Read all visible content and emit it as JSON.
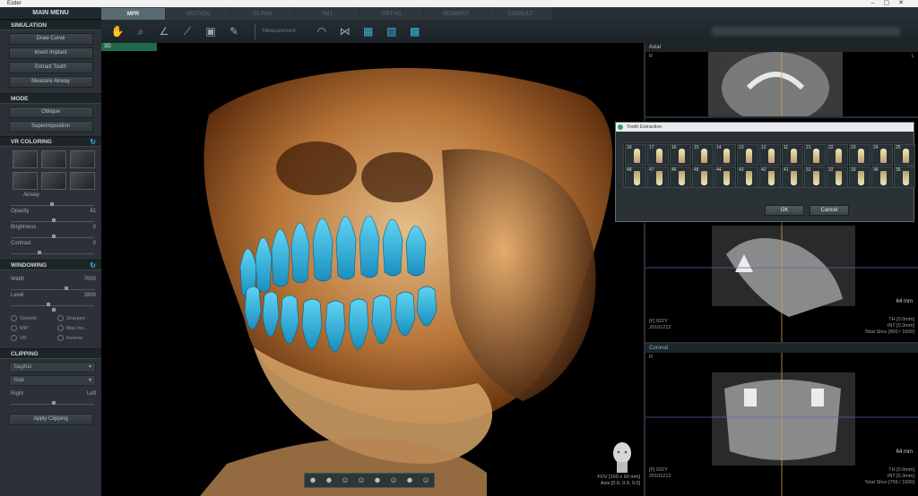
{
  "window": {
    "title": "Ezder"
  },
  "main_menu": "MAIN MENU",
  "tabs": [
    {
      "label": "MPR",
      "active": true
    },
    {
      "label": "SECTION"
    },
    {
      "label": "3D PAN"
    },
    {
      "label": "TMJ"
    },
    {
      "label": "ORTHO"
    },
    {
      "label": "SEGMENT"
    },
    {
      "label": "CONSULT"
    }
  ],
  "toolbar": {
    "measurement_label": "Measurement"
  },
  "sidebar": {
    "simulation": {
      "title": "SIMULATION",
      "buttons": [
        "Draw Curve",
        "Insert Implant",
        "Extract Tooth",
        "Measure Airway"
      ]
    },
    "mode": {
      "title": "MODE",
      "buttons": [
        "Oblique",
        "Superimposition"
      ]
    },
    "vr_coloring": {
      "title": "VR COLORING",
      "airway": "Airway",
      "opacity_label": "Opacity",
      "opacity_value": "81",
      "brightness_label": "Brightness",
      "brightness_value": "0",
      "contrast_label": "Contrast",
      "contrast_value": "0"
    },
    "windowing": {
      "title": "WINDOWING",
      "width_label": "Width",
      "width_value": "7000",
      "level_label": "Level",
      "level_value": "2800",
      "options": [
        "Smooth",
        "Sharpen",
        "MIP",
        "Max Ins...",
        "VR",
        "Inverse"
      ]
    },
    "clipping": {
      "title": "CLIPPING",
      "dropdown1": "Sagittal",
      "dropdown2": "Slab",
      "right_label": "Right",
      "left_label": "Left",
      "apply_button": "Apply Clipping"
    }
  },
  "viewport3d": {
    "label": "3D",
    "fov_line1": "FOV [160 x 90 mm]",
    "fov_line2": "Axis [0.0, 0.0, 0.0]"
  },
  "axial": {
    "title": "Axial",
    "r_label": "R",
    "l_label": "L"
  },
  "sagittal": {
    "info_bl_1": "[F] 022Y",
    "info_bl_2": "20101212",
    "mm": "64 mm",
    "info_br_1": "TH [0.0mm]",
    "info_br_2": "INT [0.3mm]",
    "info_br_3": "Total Slice [800 / 1600]"
  },
  "coronal": {
    "title": "Coronal",
    "r_label": "R",
    "info_bl_1": "[F] 022Y",
    "info_bl_2": "20101212",
    "mm": "64 mm",
    "info_br_1": "TH [0.0mm]",
    "info_br_2": "INT [0.3mm]",
    "info_br_3": "Total Slice [799 / 1600]"
  },
  "dialog": {
    "title": "Tooth Extraction",
    "upper_teeth": [
      "18",
      "17",
      "16",
      "15",
      "14",
      "13",
      "12",
      "11",
      "21",
      "22",
      "23",
      "24",
      "25"
    ],
    "lower_teeth": [
      "48",
      "47",
      "46",
      "45",
      "44",
      "43",
      "42",
      "41",
      "31",
      "32",
      "33",
      "34",
      "35"
    ],
    "ok_label": "OK",
    "cancel_label": "Cancel"
  },
  "colors": {
    "accent": "#3fb4d8",
    "panel": "#2b3136",
    "label_green": "#1f6a4a"
  }
}
